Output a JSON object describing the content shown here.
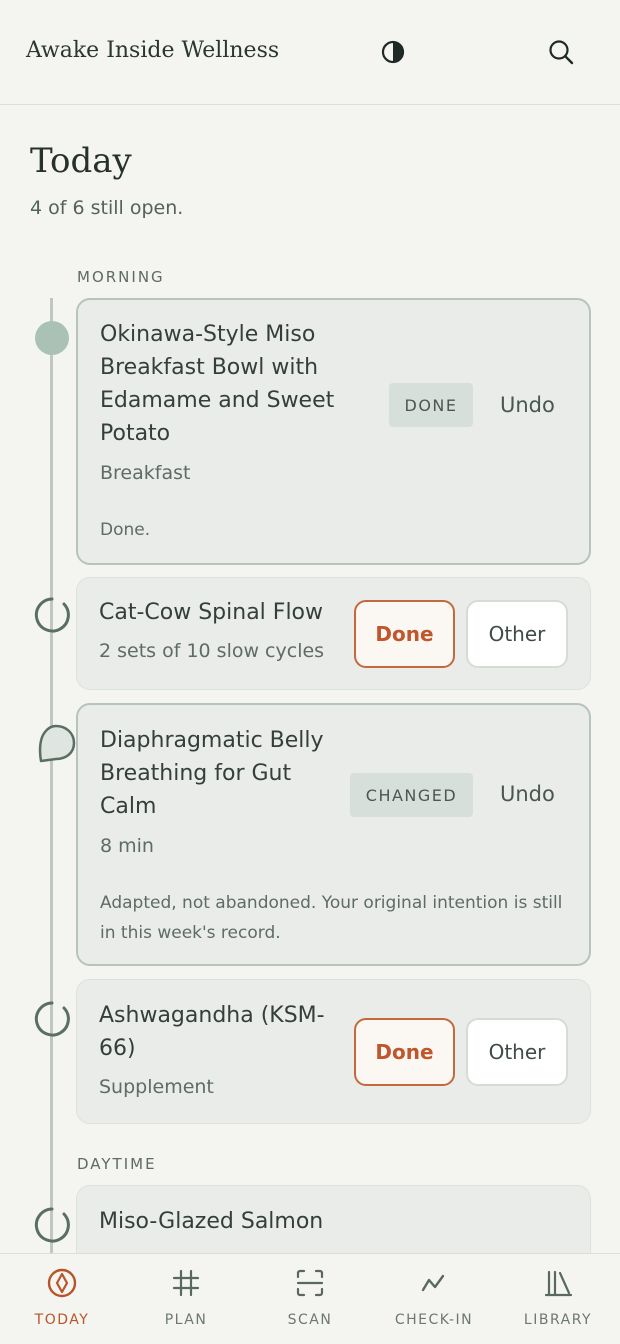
{
  "header": {
    "brand": "Awake Inside Wellness",
    "theme_icon": "contrast-icon",
    "search_icon": "search-icon"
  },
  "page": {
    "title": "Today",
    "subtitle": "4 of 6 still open."
  },
  "sections": {
    "morning": "MORNING",
    "daytime": "DAYTIME"
  },
  "items": [
    {
      "name": "Okinawa-Style Miso Breakfast Bowl with Edamame and Sweet Potato",
      "meta": "Breakfast",
      "status": "DONE",
      "undo": "Undo",
      "note": "Done."
    },
    {
      "name": "Cat-Cow Spinal Flow",
      "meta": "2 sets of 10 slow cycles",
      "done_label": "Done",
      "other_label": "Other"
    },
    {
      "name": "Diaphragmatic Belly Breathing for Gut Calm",
      "meta": "8 min",
      "status": "CHANGED",
      "undo": "Undo",
      "note": "Adapted, not abandoned. Your original intention is still in this week's record."
    },
    {
      "name": "Ashwagandha (KSM-66)",
      "meta": "Supplement",
      "done_label": "Done",
      "other_label": "Other"
    },
    {
      "name": "Miso-Glazed Salmon"
    }
  ],
  "tabs": [
    {
      "label": "TODAY",
      "icon": "compass-icon"
    },
    {
      "label": "PLAN",
      "icon": "grid-icon"
    },
    {
      "label": "SCAN",
      "icon": "scan-icon"
    },
    {
      "label": "CHECK-IN",
      "icon": "wave-icon"
    },
    {
      "label": "LIBRARY",
      "icon": "books-icon"
    }
  ],
  "colors": {
    "accent": "#c0562b",
    "node_done": "#a9c2b5",
    "node_open": "#5b6e66"
  }
}
